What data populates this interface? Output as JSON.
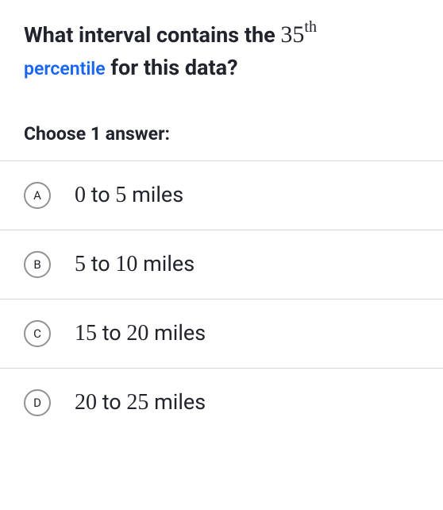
{
  "question": {
    "prefix": "What interval contains the ",
    "number": "35",
    "super": "th",
    "link_word": "percentile",
    "suffix": " for this data?"
  },
  "choose_label": "Choose 1 answer:",
  "options": [
    {
      "letter": "A",
      "n1": "0",
      "mid": " to ",
      "n2": "5",
      "unit": " miles"
    },
    {
      "letter": "B",
      "n1": "5",
      "mid": " to ",
      "n2": "10",
      "unit": " miles"
    },
    {
      "letter": "C",
      "n1": "15",
      "mid": " to ",
      "n2": "20",
      "unit": " miles"
    },
    {
      "letter": "D",
      "n1": "20",
      "mid": " to ",
      "n2": "25",
      "unit": " miles"
    }
  ]
}
